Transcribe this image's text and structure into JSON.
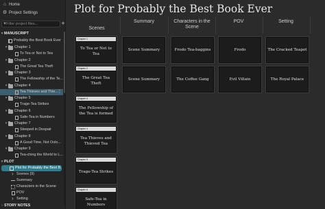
{
  "sidebar": {
    "home_label": "Home",
    "settings_label": "Project Settings",
    "filter_placeholder": "Filter project files...",
    "add_symbol": "+",
    "manuscript_header": "MANUSCRIPT",
    "book_title": "Probably the Best Book Ever",
    "chapters": [
      {
        "label": "Chapter 1",
        "scene": "To Tea or Not to Tea"
      },
      {
        "label": "Chapter 2",
        "scene": "The Great Tea Theft"
      },
      {
        "label": "Chapter 3",
        "scene": "The Fellowship of the Te..."
      },
      {
        "label": "Chapter 4",
        "scene": "Tea Thieves and Thie..."
      },
      {
        "label": "Chapter 5",
        "scene": "Trage-Tea Strikes"
      },
      {
        "label": "Chapter 6",
        "scene": "Safe-Tea in Numbers"
      },
      {
        "label": "Chapter 7",
        "scene": "Steeped in Despair"
      },
      {
        "label": "Chapter 8",
        "scene": "A Good Time, Not Oolo..."
      },
      {
        "label": "Chapter 9",
        "scene": "Tea-ching the World to L..."
      }
    ],
    "kebab": "⋮",
    "plot_header": "PLOT",
    "plot_item": "Plot for Probably the Best B...",
    "plot_children": [
      "Scenes (9)",
      "Summary",
      "Characters in the Scene",
      "POV",
      "Setting"
    ],
    "story_notes_header": "STORY NOTES"
  },
  "main": {
    "title": "Plot for Probably the Best Book Ever",
    "columns": [
      "Scenes",
      "Summary",
      "Characters in the Scene",
      "POV",
      "Setting"
    ],
    "rows": [
      {
        "chapter": "Chapter 1",
        "scene": "To Tea or Not to Tea",
        "summary": "Scene Summary",
        "characters": "Frodo Tea-baggins",
        "pov": "Frodo",
        "setting": "The Cracked Teapot"
      },
      {
        "chapter": "Chapter 2",
        "scene": "The Great Tea Theft",
        "summary": "Scene Summary",
        "characters": "The Coffee Gang",
        "pov": "Evil Villain",
        "setting": "The Royal Palace"
      },
      {
        "chapter": "Chapter 3",
        "scene": "The Fellowship of the Tea is formed"
      },
      {
        "chapter": "Chapter 4",
        "scene": "Tea Thieves and Thieved Tea"
      },
      {
        "chapter": "Chapter 5",
        "scene": "Trage-Tea Strikes"
      },
      {
        "chapter": "Chapter 6",
        "scene": "Safe-Tea in Numbers"
      }
    ]
  },
  "icons": {
    "home": "home-icon",
    "settings": "gear-icon",
    "filter": "filter-icon",
    "add": "plus-icon"
  }
}
